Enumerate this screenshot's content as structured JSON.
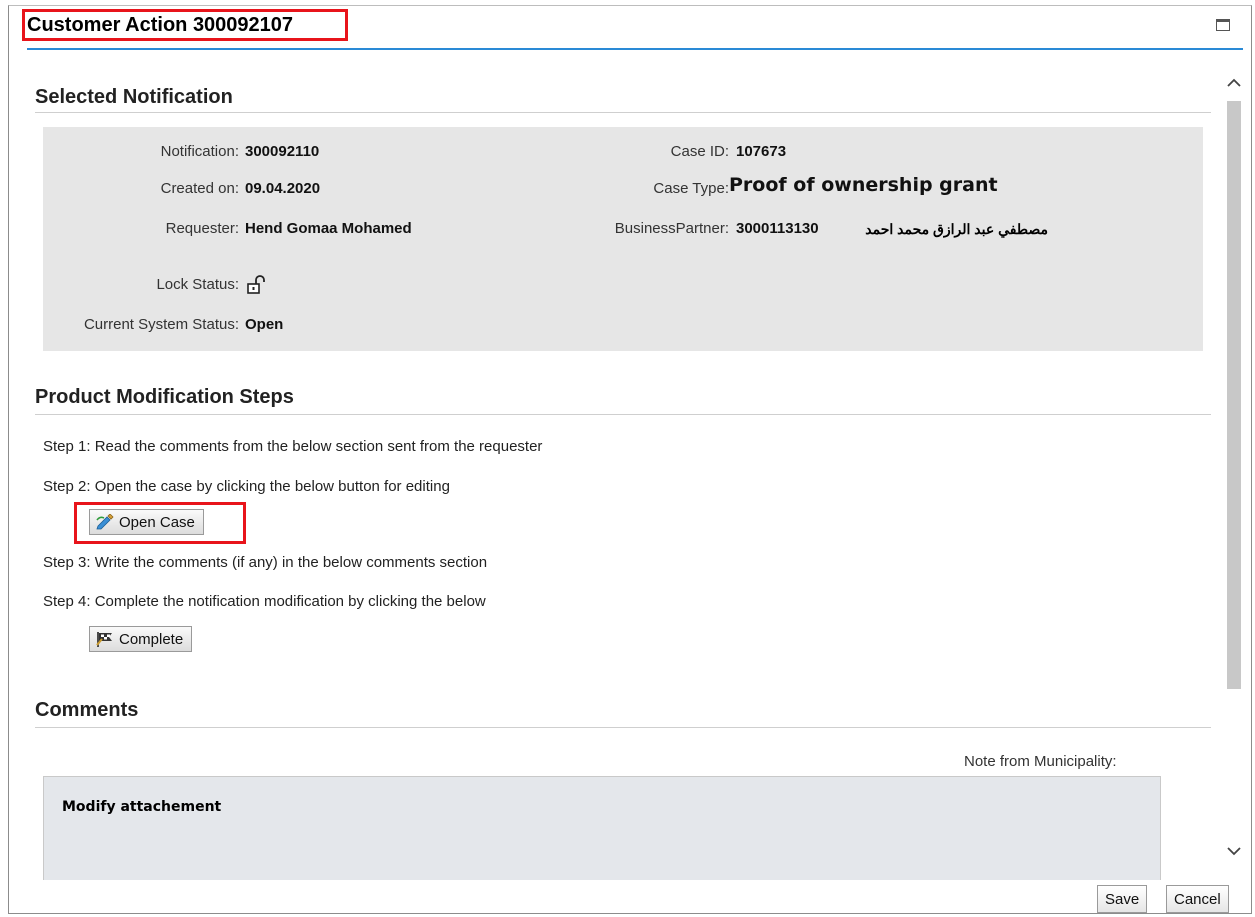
{
  "window": {
    "title": "Customer Action 300092107"
  },
  "selected_notification": {
    "heading": "Selected Notification",
    "notification_label": "Notification:",
    "notification_value": "300092110",
    "created_label": "Created on:",
    "created_value": "09.04.2020",
    "requester_label": "Requester:",
    "requester_value": "Hend Gomaa Mohamed",
    "lock_label": "Lock Status:",
    "lock_icon": "unlocked-padlock-icon",
    "status_label": "Current System Status:",
    "status_value": "Open",
    "case_id_label": "Case ID:",
    "case_id_value": "107673",
    "case_type_label": "Case Type:",
    "case_type_value": "Proof of ownership grant",
    "bp_label": "BusinessPartner:",
    "bp_number": "3000113130",
    "bp_name": "مصطفي عبد الرازق محمد احمد"
  },
  "steps": {
    "heading": "Product Modification Steps",
    "step1": "Step 1: Read the comments from the below section sent from the requester",
    "step2": "Step 2: Open the case by clicking the below button for editing",
    "open_case_label": "Open Case",
    "step3": "Step 3: Write the comments (if any) in the below comments section",
    "step4": "Step 4: Complete the notification modification by clicking the below",
    "complete_label": "Complete"
  },
  "comments": {
    "heading": "Comments",
    "note_label": "Note from Municipality:",
    "note_text": "Modify attachement"
  },
  "footer": {
    "save_label": "Save",
    "cancel_label": "Cancel"
  },
  "colors": {
    "highlight": "#e8141b",
    "title_rule": "#2a8ad6",
    "panel_bg": "#e6e6e6"
  }
}
